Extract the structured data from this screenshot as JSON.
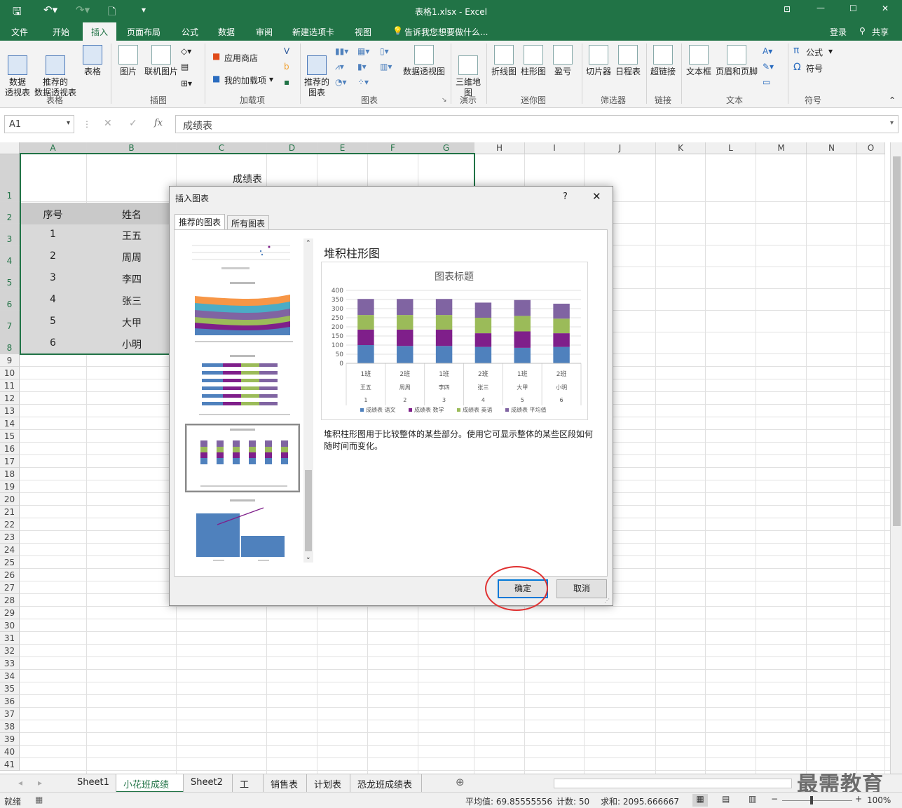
{
  "window": {
    "title": "表格1.xlsx - Excel",
    "login": "登录",
    "share": "共享"
  },
  "ribbon_tabs": [
    "文件",
    "开始",
    "插入",
    "页面布局",
    "公式",
    "数据",
    "审阅",
    "新建选项卡",
    "视图"
  ],
  "tell_me": "告诉我您想要做什么...",
  "ribbon": {
    "pivot": "数据\n透视表",
    "rec_pivot": "推荐的\n数据透视表",
    "table": "表格",
    "group_table": "表格",
    "picture": "图片",
    "online_picture": "联机图片",
    "group_illustrations": "插图",
    "store": "应用商店",
    "my_addins": "我的加载项",
    "group_addins": "加载项",
    "rec_charts": "推荐的\n图表",
    "pivot_chart": "数据透视图",
    "group_charts": "图表",
    "map3d": "三维地\n图",
    "group_tours": "演示",
    "line": "折线图",
    "column": "柱形图",
    "winloss": "盈亏",
    "group_sparklines": "迷你图",
    "slicer": "切片器",
    "timeline": "日程表",
    "group_filters": "筛选器",
    "hyperlink": "超链接",
    "group_links": "链接",
    "textbox": "文本框",
    "header_footer": "页眉和页脚",
    "group_text": "文本",
    "equation": "公式",
    "symbol": "符号",
    "group_symbols": "符号"
  },
  "formula_bar": {
    "name_box": "A1",
    "fx": "fx",
    "content": "成绩表"
  },
  "columns": [
    "A",
    "B",
    "C",
    "D",
    "E",
    "F",
    "G",
    "H",
    "I",
    "J",
    "K",
    "L",
    "M",
    "N",
    "O"
  ],
  "rows": [
    "1",
    "2",
    "3",
    "4",
    "5",
    "6",
    "7",
    "8",
    "9",
    "10",
    "11",
    "12",
    "13",
    "14",
    "15",
    "16",
    "17",
    "18",
    "19",
    "20",
    "21",
    "22",
    "23",
    "24",
    "25",
    "26",
    "27",
    "28",
    "29",
    "30",
    "31",
    "32",
    "33",
    "34",
    "35",
    "36",
    "37",
    "38",
    "39",
    "40",
    "41"
  ],
  "sheet": {
    "title": "成绩表",
    "headers": [
      "序号",
      "姓名"
    ],
    "data": [
      [
        "1",
        "王五"
      ],
      [
        "2",
        "周周"
      ],
      [
        "3",
        "李四"
      ],
      [
        "4",
        "张三"
      ],
      [
        "5",
        "大甲"
      ],
      [
        "6",
        "小明"
      ]
    ]
  },
  "dialog": {
    "title": "插入图表",
    "help": "?",
    "close": "✕",
    "tab_recommended": "推荐的图表",
    "tab_all": "所有图表",
    "preview_name": "堆积柱形图",
    "description": "堆积柱形图用于比较整体的某些部分。使用它可显示整体的某些区段如何随时间而变化。",
    "ok": "确定",
    "cancel": "取消"
  },
  "chart_data": {
    "type": "bar",
    "stacked": true,
    "title": "图表标题",
    "categories": [
      [
        "1班",
        "王五",
        "1"
      ],
      [
        "2班",
        "周周",
        "2"
      ],
      [
        "1班",
        "李四",
        "3"
      ],
      [
        "2班",
        "张三",
        "4"
      ],
      [
        "1班",
        "大甲",
        "5"
      ],
      [
        "2班",
        "小明",
        "6"
      ]
    ],
    "ylim": [
      0,
      400
    ],
    "yticks": [
      0,
      50,
      100,
      150,
      200,
      250,
      300,
      350,
      400
    ],
    "series": [
      {
        "name": "成绩表 语文",
        "color": "#4f81bd",
        "values": [
          100,
          95,
          95,
          90,
          85,
          90
        ]
      },
      {
        "name": "成绩表 数学",
        "color": "#7f1f8a",
        "values": [
          85,
          90,
          90,
          75,
          90,
          75
        ]
      },
      {
        "name": "成绩表 英语",
        "color": "#9bbb59",
        "values": [
          80,
          80,
          80,
          85,
          85,
          80
        ]
      },
      {
        "name": "成绩表 平均值",
        "color": "#8064a2",
        "values": [
          88,
          88,
          88,
          83,
          87,
          82
        ]
      }
    ],
    "grid": true,
    "legend": "bottom"
  },
  "sheet_tabs": [
    "Sheet1",
    "小花班成绩表",
    "Sheet2",
    "工资",
    "销售表",
    "计划表",
    "恐龙班成绩表"
  ],
  "active_sheet": 1,
  "status": {
    "ready": "就绪",
    "average": "平均值: 69.85555556",
    "count": "计数: 50",
    "sum": "求和: 2095.666667",
    "zoom": "100%"
  },
  "watermark": "最需教育"
}
